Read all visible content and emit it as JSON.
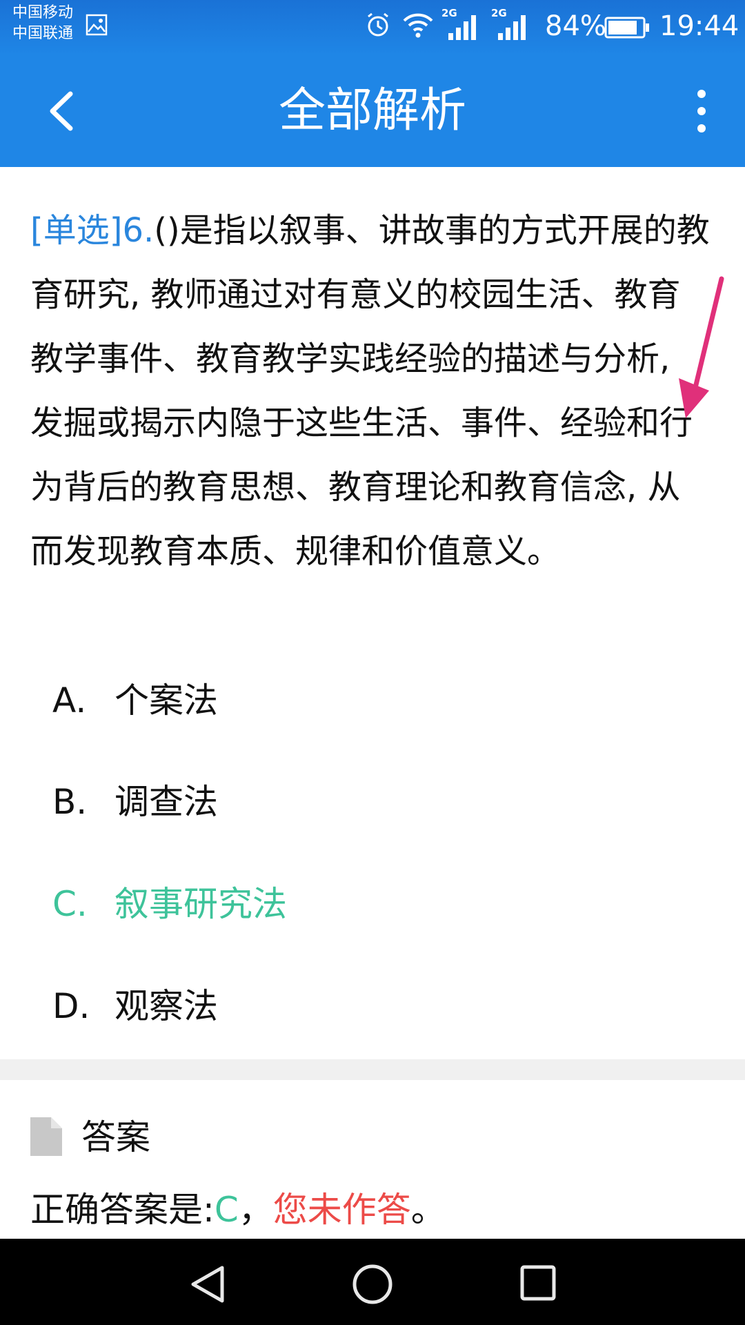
{
  "status_bar": {
    "carrier_1": "中国移动",
    "carrier_2": "中国联通",
    "signal_1_label": "2G",
    "signal_2_label": "2G",
    "battery": "84%",
    "time": "19:44"
  },
  "header": {
    "title": "全部解析",
    "color": "#1f86e6"
  },
  "question": {
    "tag": "[单选]6.",
    "text": "()是指以叙事、讲故事的方式开展的教育研究, 教师通过对有意义的校园生活、教育教学事件、教育教学实践经验的描述与分析, 发掘或揭示内隐于这些生活、事件、经验和行为背后的教育思想、教育理论和教育信念, 从而发现教育本质、规律和价值意义。"
  },
  "options": [
    {
      "letter": "A.",
      "text": "个案法"
    },
    {
      "letter": "B.",
      "text": "调查法"
    },
    {
      "letter": "C.",
      "text": "叙事研究法",
      "highlight_color": "#3ec39a"
    },
    {
      "letter": "D.",
      "text": "观察法"
    }
  ],
  "answer": {
    "section_title": "答案",
    "prefix": "正确答案是:",
    "letter": "C",
    "separator": "，",
    "status": "您未作答",
    "suffix": "。",
    "status_color": "#ec4b48"
  }
}
